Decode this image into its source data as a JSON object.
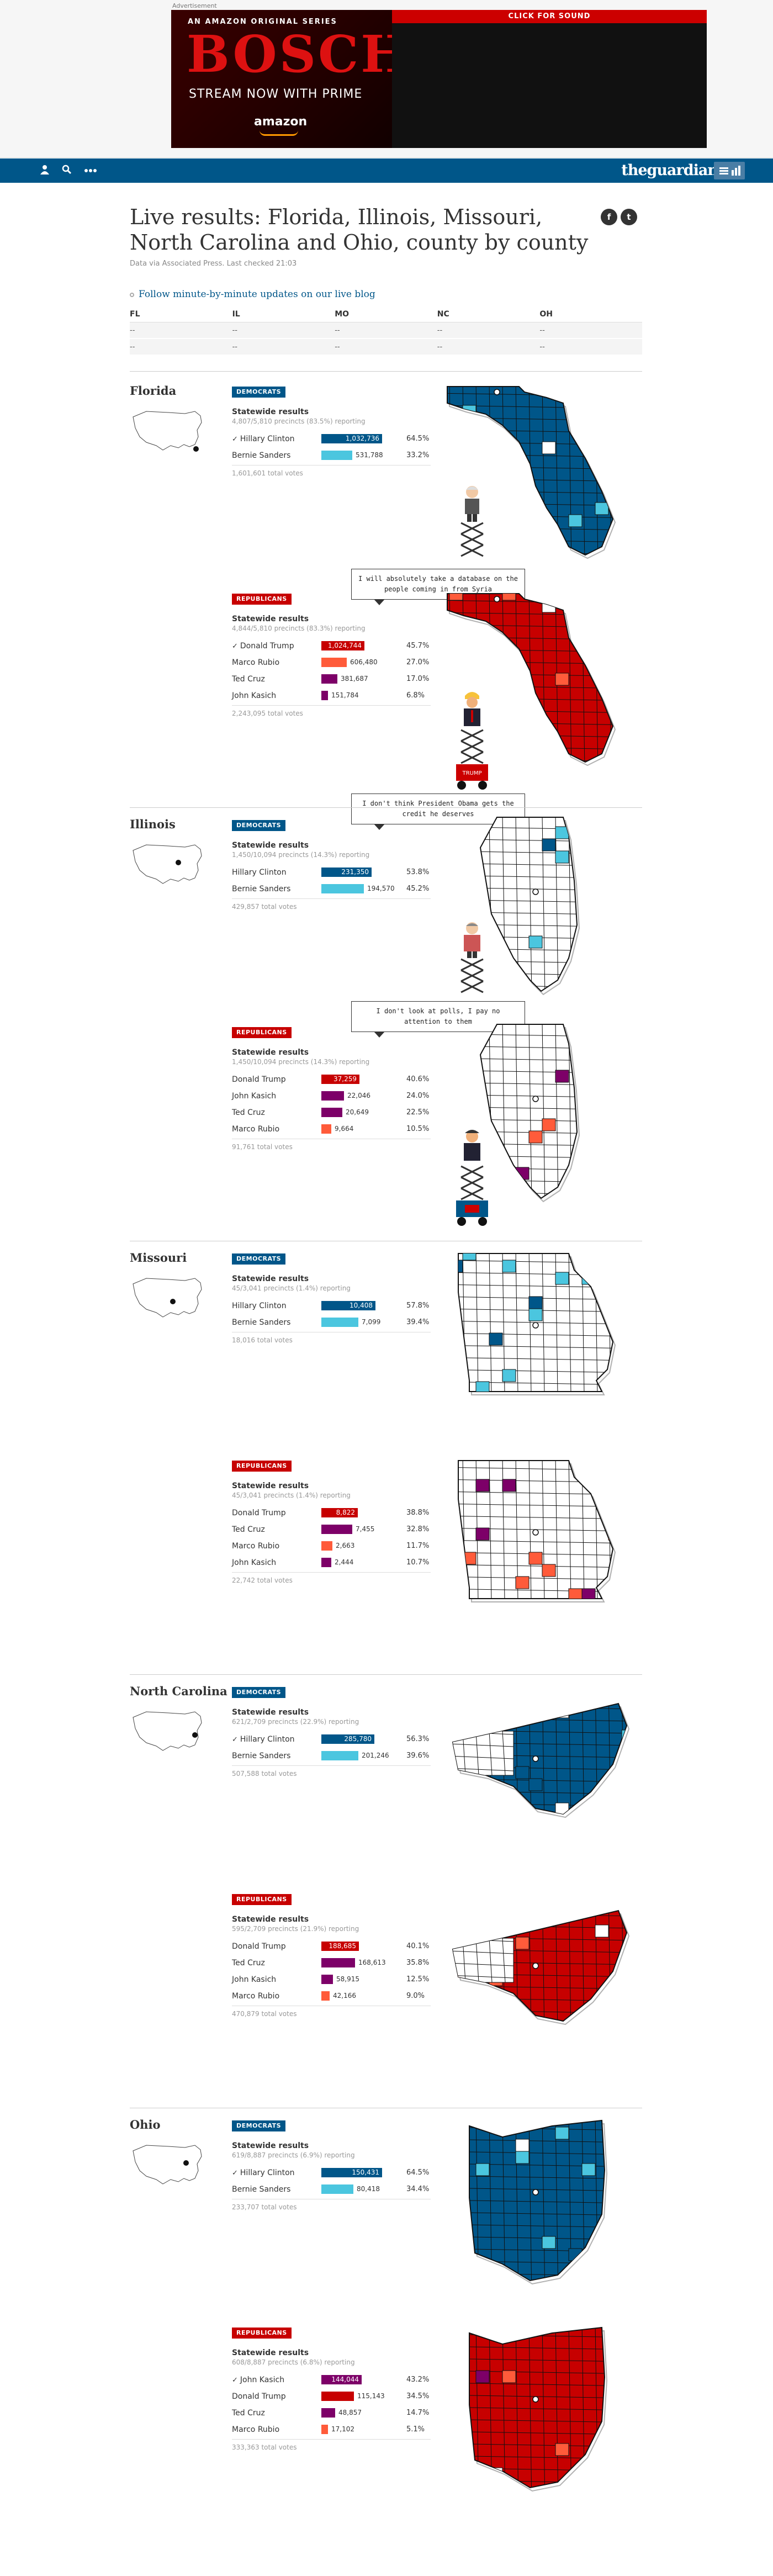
{
  "ad": {
    "label": "Advertisement",
    "top_line": "AN AMAZON ORIGINAL SERIES",
    "brand": "BOSCH",
    "tagline": "STREAM NOW WITH PRIME",
    "amazon": "amazon",
    "sound": "CLICK FOR SOUND"
  },
  "header": {
    "logo": "theguardian",
    "icons": [
      "profile-icon",
      "search-icon",
      "more-icon",
      "menu-icon"
    ]
  },
  "page": {
    "title": "Live results: Florida, Illinois, Missouri, North Carolina and Ohio, county by county",
    "meta": "Data via Associated Press. Last checked 21:03",
    "liveblog": "Follow minute-by-minute updates on our live blog",
    "share": [
      "f",
      "t"
    ]
  },
  "summary": {
    "columns": [
      "FL",
      "IL",
      "MO",
      "NC",
      "OH"
    ],
    "rows": [
      [
        "--",
        "--",
        "--",
        "--",
        "--"
      ],
      [
        "--",
        "--",
        "--",
        "--",
        "--"
      ]
    ]
  },
  "colors": {
    "dem": "#005689",
    "dem_light": "#4bc6df",
    "rep": "#c70000",
    "trump": "#c70000",
    "kasich": "#7d0068",
    "cruz": "#7d0068",
    "rubio": "#ff5b3a"
  },
  "florida": {
    "name": "Florida",
    "dem": {
      "badge": "DEMOCRATS",
      "heading": "Statewide results",
      "precincts": "4,807/5,810 precincts (83.5%) reporting",
      "candidates": [
        {
          "name": "Hillary Clinton",
          "winner": true,
          "votes": "1,032,736",
          "pct": "64.5%",
          "share": 0.645
        },
        {
          "name": "Bernie Sanders",
          "winner": false,
          "votes": "531,788",
          "pct": "33.2%",
          "share": 0.332
        }
      ],
      "total": "1,601,601 total votes"
    },
    "rep": {
      "badge": "REPUBLICANS",
      "heading": "Statewide results",
      "precincts": "4,844/5,810 precincts (83.3%) reporting",
      "candidates": [
        {
          "name": "Donald Trump",
          "winner": true,
          "votes": "1,024,744",
          "pct": "45.7%",
          "share": 0.457
        },
        {
          "name": "Marco Rubio",
          "winner": false,
          "votes": "606,480",
          "pct": "27.0%",
          "share": 0.27
        },
        {
          "name": "Ted Cruz",
          "winner": false,
          "votes": "381,687",
          "pct": "17.0%",
          "share": 0.17
        },
        {
          "name": "John Kasich",
          "winner": false,
          "votes": "151,784",
          "pct": "6.8%",
          "share": 0.068
        }
      ],
      "total": "2,243,095 total votes"
    },
    "quote": "I will absolutely take a database on the people coming in from Syria"
  },
  "illinois": {
    "name": "Illinois",
    "dem": {
      "badge": "DEMOCRATS",
      "heading": "Statewide results",
      "precincts": "1,450/10,094 precincts (14.3%) reporting",
      "candidates": [
        {
          "name": "Hillary Clinton",
          "winner": false,
          "votes": "231,350",
          "pct": "53.8%",
          "share": 0.538
        },
        {
          "name": "Bernie Sanders",
          "winner": false,
          "votes": "194,570",
          "pct": "45.2%",
          "share": 0.452
        }
      ],
      "total": "429,857 total votes"
    },
    "rep": {
      "badge": "REPUBLICANS",
      "heading": "Statewide results",
      "precincts": "1,450/10,094 precincts (14.3%) reporting",
      "candidates": [
        {
          "name": "Donald Trump",
          "winner": false,
          "votes": "37,259",
          "pct": "40.6%",
          "share": 0.406
        },
        {
          "name": "John Kasich",
          "winner": false,
          "votes": "22,046",
          "pct": "24.0%",
          "share": 0.24
        },
        {
          "name": "Ted Cruz",
          "winner": false,
          "votes": "20,649",
          "pct": "22.5%",
          "share": 0.225
        },
        {
          "name": "Marco Rubio",
          "winner": false,
          "votes": "9,664",
          "pct": "10.5%",
          "share": 0.105
        }
      ],
      "total": "91,761 total votes"
    },
    "quote": "I don't think President Obama gets the credit he deserves",
    "quote2": "I don't look at polls, I pay no attention to them"
  },
  "missouri": {
    "name": "Missouri",
    "dem": {
      "badge": "DEMOCRATS",
      "heading": "Statewide results",
      "precincts": "45/3,041 precincts (1.4%) reporting",
      "candidates": [
        {
          "name": "Hillary Clinton",
          "winner": false,
          "votes": "10,408",
          "pct": "57.8%",
          "share": 0.578
        },
        {
          "name": "Bernie Sanders",
          "winner": false,
          "votes": "7,099",
          "pct": "39.4%",
          "share": 0.394
        }
      ],
      "total": "18,016 total votes"
    },
    "rep": {
      "badge": "REPUBLICANS",
      "heading": "Statewide results",
      "precincts": "45/3,041 precincts (1.4%) reporting",
      "candidates": [
        {
          "name": "Donald Trump",
          "winner": false,
          "votes": "8,822",
          "pct": "38.8%",
          "share": 0.388
        },
        {
          "name": "Ted Cruz",
          "winner": false,
          "votes": "7,455",
          "pct": "32.8%",
          "share": 0.328
        },
        {
          "name": "Marco Rubio",
          "winner": false,
          "votes": "2,663",
          "pct": "11.7%",
          "share": 0.117
        },
        {
          "name": "John Kasich",
          "winner": false,
          "votes": "2,444",
          "pct": "10.7%",
          "share": 0.107
        }
      ],
      "total": "22,742 total votes"
    }
  },
  "north_carolina": {
    "name": "North Carolina",
    "dem": {
      "badge": "DEMOCRATS",
      "heading": "Statewide results",
      "precincts": "621/2,709 precincts (22.9%) reporting",
      "candidates": [
        {
          "name": "Hillary Clinton",
          "winner": true,
          "votes": "285,780",
          "pct": "56.3%",
          "share": 0.563
        },
        {
          "name": "Bernie Sanders",
          "winner": false,
          "votes": "201,246",
          "pct": "39.6%",
          "share": 0.396
        }
      ],
      "total": "507,588 total votes"
    },
    "rep": {
      "badge": "REPUBLICANS",
      "heading": "Statewide results",
      "precincts": "595/2,709 precincts (21.9%) reporting",
      "candidates": [
        {
          "name": "Donald Trump",
          "winner": false,
          "votes": "188,685",
          "pct": "40.1%",
          "share": 0.401
        },
        {
          "name": "Ted Cruz",
          "winner": false,
          "votes": "168,613",
          "pct": "35.8%",
          "share": 0.358
        },
        {
          "name": "John Kasich",
          "winner": false,
          "votes": "58,915",
          "pct": "12.5%",
          "share": 0.125
        },
        {
          "name": "Marco Rubio",
          "winner": false,
          "votes": "42,166",
          "pct": "9.0%",
          "share": 0.09
        }
      ],
      "total": "470,879 total votes"
    }
  },
  "ohio": {
    "name": "Ohio",
    "dem": {
      "badge": "DEMOCRATS",
      "heading": "Statewide results",
      "precincts": "619/8,887 precincts (6.9%) reporting",
      "candidates": [
        {
          "name": "Hillary Clinton",
          "winner": true,
          "votes": "150,431",
          "pct": "64.5%",
          "share": 0.645
        },
        {
          "name": "Bernie Sanders",
          "winner": false,
          "votes": "80,418",
          "pct": "34.4%",
          "share": 0.344
        }
      ],
      "total": "233,707 total votes"
    },
    "rep": {
      "badge": "REPUBLICANS",
      "heading": "Statewide results",
      "precincts": "608/8,887 precincts (6.8%) reporting",
      "candidates": [
        {
          "name": "John Kasich",
          "winner": true,
          "votes": "144,044",
          "pct": "43.2%",
          "share": 0.432
        },
        {
          "name": "Donald Trump",
          "winner": false,
          "votes": "115,143",
          "pct": "34.5%",
          "share": 0.345
        },
        {
          "name": "Ted Cruz",
          "winner": false,
          "votes": "48,857",
          "pct": "14.7%",
          "share": 0.147
        },
        {
          "name": "Marco Rubio",
          "winner": false,
          "votes": "17,102",
          "pct": "5.1%",
          "share": 0.051
        }
      ],
      "total": "333,363 total votes"
    }
  }
}
